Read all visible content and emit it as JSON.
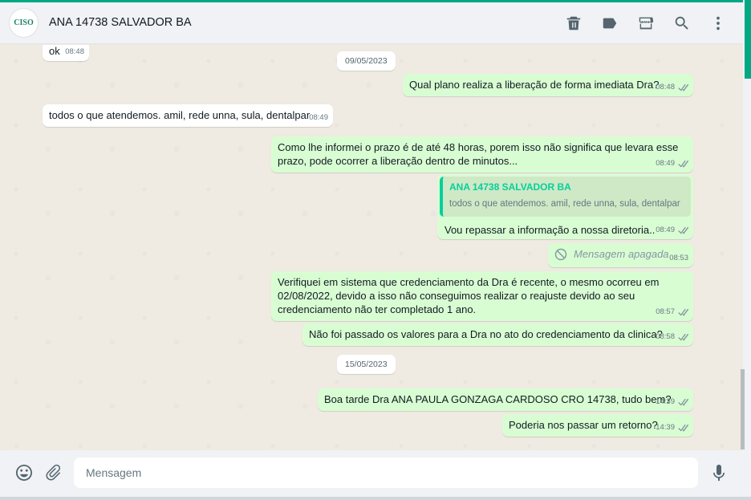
{
  "header": {
    "contact_name": "ANA 14738 SALVADOR BA",
    "avatar_text": "CISO",
    "icons": [
      "trash-icon",
      "label-icon",
      "store-icon",
      "search-icon",
      "menu-icon"
    ]
  },
  "messages": [
    {
      "dir": "in",
      "text": "ok",
      "time": "08:48"
    },
    {
      "type": "date",
      "text": "09/05/2023"
    },
    {
      "dir": "out",
      "text": "Qual plano realiza a liberação de forma imediata Dra?",
      "time": "08:48"
    },
    {
      "dir": "in",
      "text": "todos o que atendemos. amil, rede unna, sula, dentalpar",
      "time": "08:49"
    },
    {
      "dir": "out",
      "lines": [
        "Como lhe informei o prazo é de até 48 horas, porem isso não significa que levara esse",
        "prazo, pode ocorrer a liberação dentro de minutos..."
      ],
      "time": "08:49"
    },
    {
      "dir": "out",
      "quote_name": "ANA 14738 SALVADOR BA",
      "quote_text": "todos o que atendemos. amil, rede unna, sula, dentalpar",
      "text": "Vou repassar a informação a nossa diretoria..",
      "time": "08:49"
    },
    {
      "dir": "out",
      "deleted": true,
      "text": "Mensagem apagada",
      "time": "08:53"
    },
    {
      "dir": "out",
      "lines": [
        "Verifiquei em sistema que credenciamento da Dra é recente, o mesmo ocorreu em",
        "02/08/2022, devido a isso não conseguimos realizar o reajuste devido ao seu",
        "credenciamento não ter completado 1 ano."
      ],
      "time": "08:57"
    },
    {
      "dir": "out",
      "text": "Não foi passado os valores para a Dra no ato do credenciamento da clinica?",
      "time": "08:58"
    },
    {
      "type": "date",
      "text": "15/05/2023"
    },
    {
      "dir": "out",
      "text": "Boa tarde Dra ANA PAULA GONZAGA CARDOSO CRO 14738, tudo bem?",
      "time": "14:39"
    },
    {
      "dir": "out",
      "text": "Poderia nos passar um retorno?",
      "time": "14:39"
    }
  ],
  "footer": {
    "placeholder": "Mensagem"
  },
  "colors": {
    "accent": "#00a884",
    "outgoing_bubble": "#d9fdd3",
    "incoming_bubble": "#ffffff",
    "chat_background": "#efeae2"
  }
}
